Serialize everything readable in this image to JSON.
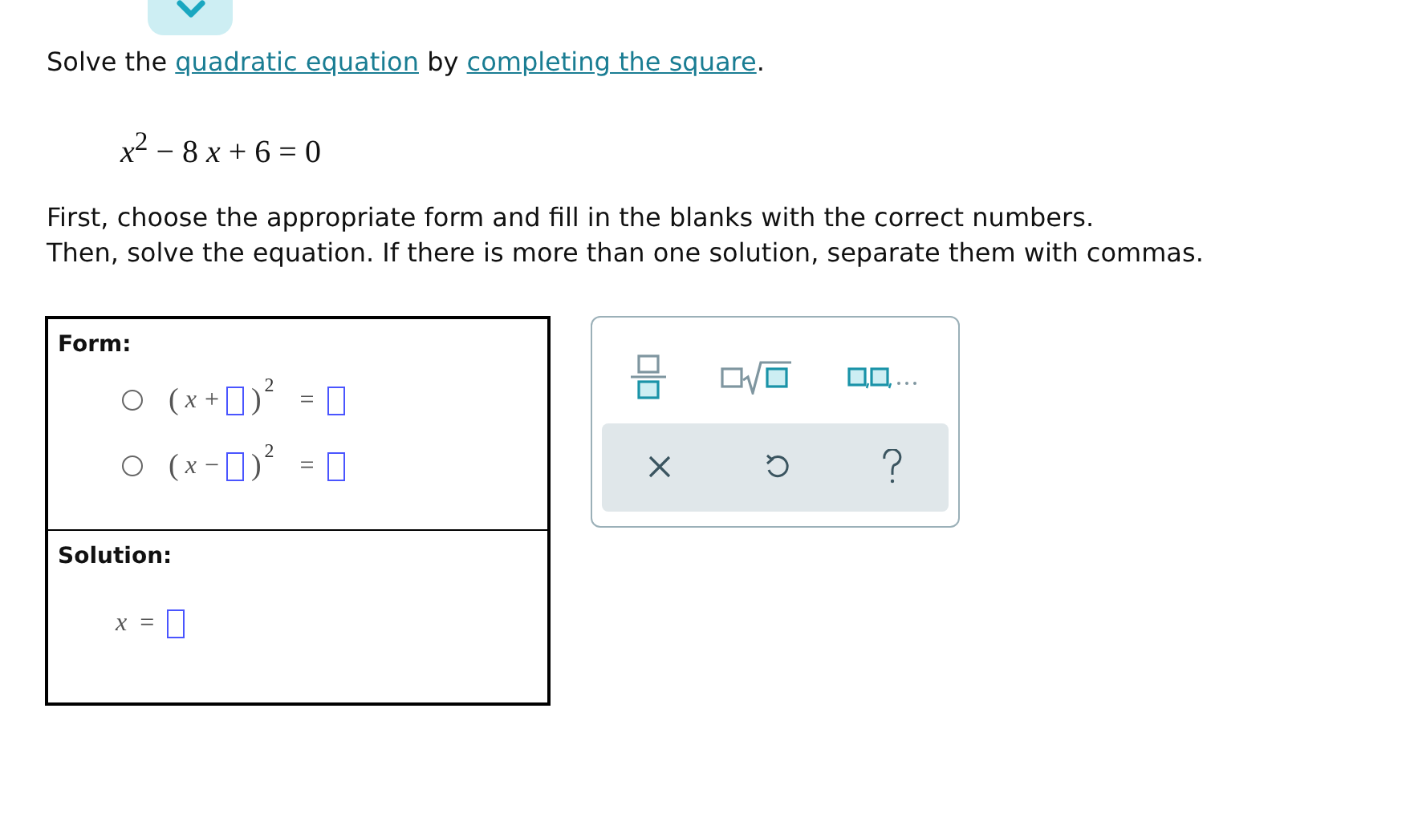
{
  "intro": [
    {
      "kind": "text",
      "text": "Solve the "
    },
    {
      "kind": "link",
      "text": "quadratic equation"
    },
    {
      "kind": "text",
      "text": " by "
    },
    {
      "kind": "link",
      "text": "completing the square"
    },
    {
      "kind": "text",
      "text": "."
    }
  ],
  "equation": "*x*$^{2}$ − 8 *x* + 6 = 0",
  "instructions": [
    "First, choose the appropriate form and fill in the blanks with the correct numbers.",
    "Then, solve the equation. If there is more than one solution, separate them with commas."
  ],
  "form": {
    "label": "Form:",
    "options": [
      {
        "open": "(",
        "variable": "x",
        "sign": "+",
        "close": ")",
        "exponent": "2",
        "equals": "=",
        "selected": false
      },
      {
        "open": "(",
        "variable": "x",
        "sign": "−",
        "close": ")",
        "exponent": "2",
        "equals": "=",
        "selected": false
      }
    ]
  },
  "solution": {
    "label": "Solution:",
    "variable": "x",
    "equals": "="
  }
}
